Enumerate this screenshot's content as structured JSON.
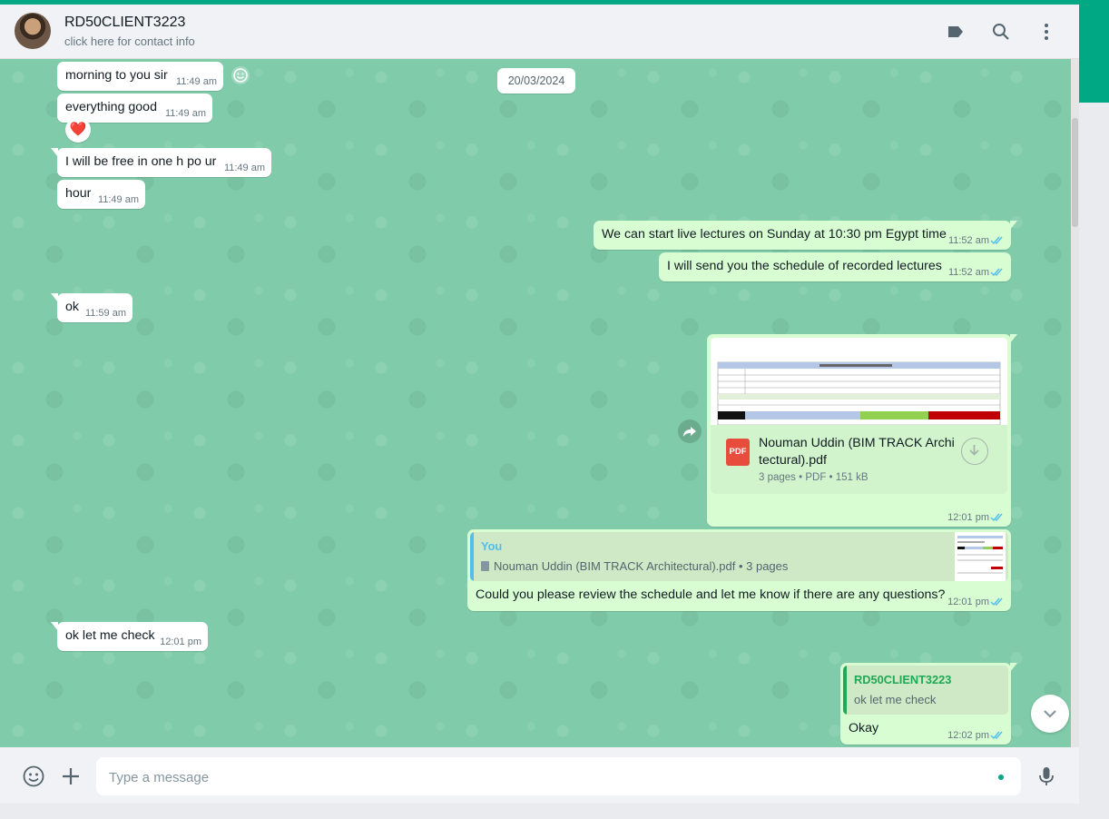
{
  "header": {
    "contact_name": "RD50CLIENT3223",
    "contact_subtitle": "click here for contact info"
  },
  "date_separator": "20/03/2024",
  "messages": [
    {
      "dir": "in",
      "text": "morning to you sir",
      "time": "11:49 am"
    },
    {
      "dir": "in",
      "text": "everything good",
      "time": "11:49 am",
      "reaction": "❤️"
    },
    {
      "dir": "in",
      "text": "I will be free in one h po ur",
      "time": "11:49 am"
    },
    {
      "dir": "in",
      "text": "hour",
      "time": "11:49 am"
    },
    {
      "dir": "out",
      "text": "We can start live lectures on Sunday at 10:30 pm Egypt time",
      "time": "11:52 am",
      "status": "read"
    },
    {
      "dir": "out",
      "text": "I will send you the schedule of recorded lectures",
      "time": "11:52 am",
      "status": "read"
    },
    {
      "dir": "in",
      "text": "ok",
      "time": "11:59 am"
    },
    {
      "dir": "out",
      "type": "document",
      "file_name": "Nouman Uddin (BIM TRACK Archi tectural).pdf",
      "file_meta": "3 pages • PDF • 151 kB",
      "time": "12:01 pm",
      "status": "read"
    },
    {
      "dir": "out",
      "reply_author": "You",
      "reply_text": "Nouman Uddin (BIM TRACK Architectural).pdf • 3 pages",
      "text": "Could you please review the schedule and let me know if there are any questions?",
      "time": "12:01 pm",
      "status": "read"
    },
    {
      "dir": "in",
      "text": "ok let me check",
      "time": "12:01 pm"
    },
    {
      "dir": "out",
      "reply_author": "RD50CLIENT3223",
      "reply_text": "ok let me check",
      "text": "Okay",
      "time": "12:02 pm",
      "status": "read"
    }
  ],
  "composer": {
    "placeholder": "Type a message"
  },
  "colors": {
    "accent": "#00a884",
    "chat_wallpaper": "#80ccaa",
    "outgoing_bubble": "#d9fdd3",
    "incoming_bubble": "#ffffff",
    "read_ticks": "#53bdeb",
    "reply_author_you": "#06cf9c",
    "reply_author_contact": "#1fa855"
  },
  "icons": [
    "label-icon",
    "search-icon",
    "menu-icon",
    "emoji-icon",
    "attach-plus-icon",
    "mic-icon",
    "forward-icon",
    "download-icon",
    "chevron-down-icon",
    "pdf-icon",
    "smiley-react-icon",
    "document-icon"
  ]
}
